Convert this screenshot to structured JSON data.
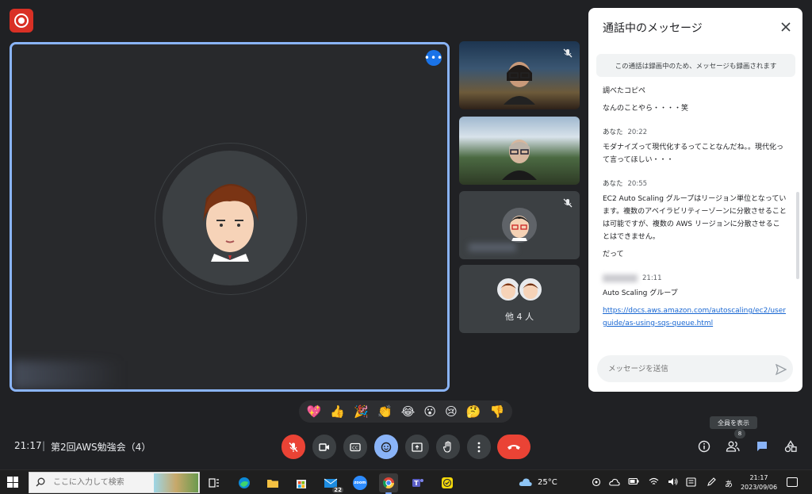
{
  "meeting": {
    "time": "21:17",
    "separator": "|",
    "name": "第2回AWS勉強会（4）"
  },
  "tiles": {
    "others_label": "他 4 人"
  },
  "chat": {
    "title": "通話中のメッセージ",
    "notice": "この通話は録画中のため、メッセージも録画されます",
    "messages": [
      {
        "lines": [
          "調べたコピペ",
          "なんのことやら・・・・笑"
        ]
      },
      {
        "sender": "あなた",
        "time": "20:22",
        "lines": [
          "モダナイズって現代化するってことなんだね。。現代化って言ってほしい・・・"
        ]
      },
      {
        "sender": "あなた",
        "time": "20:55",
        "lines": [
          "EC2 Auto Scaling グループはリージョン単位となっています。複数のアベイラビリティーゾーンに分散させることは可能ですが、複数の AWS リージョンに分散させることはできません。",
          "だって"
        ]
      },
      {
        "time": "21:11",
        "lines": [
          "Auto Scaling グループ"
        ],
        "link": "https://docs.aws.amazon.com/autoscaling/ec2/userguide/as-using-sqs-queue.html"
      }
    ],
    "input_placeholder": "メッセージを送信"
  },
  "reactions": [
    "💖",
    "👍",
    "🎉",
    "👏",
    "😂",
    "😮",
    "😢",
    "🤔",
    "👎"
  ],
  "controls": {
    "tooltip": "全員を表示",
    "people_count": "8"
  },
  "taskbar": {
    "search_placeholder": "ここに入力して検索",
    "mail_badge": "22",
    "zoom_label": "zoom",
    "weather": "25°C",
    "ime": "あ",
    "clock_time": "21:17",
    "clock_date": "2023/09/06"
  },
  "colors": {
    "meet_bg": "#202124",
    "active_border": "#8ab4f8",
    "end_call": "#ea4335",
    "accent": "#1a73e8"
  },
  "icons": {
    "record": "record-icon",
    "mic_off": "mic-off-icon",
    "camera": "camera-icon",
    "captions": "captions-icon",
    "emoji": "emoji-icon",
    "present": "present-icon",
    "hand": "raise-hand-icon",
    "more": "more-vert-icon",
    "end_call": "end-call-icon",
    "info": "info-icon",
    "people": "people-icon",
    "chat": "chat-icon",
    "activities": "activities-icon"
  }
}
